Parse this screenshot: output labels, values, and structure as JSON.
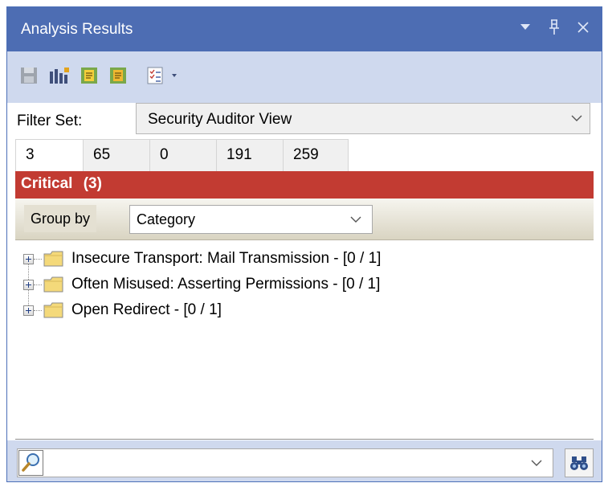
{
  "window": {
    "title": "Analysis Results",
    "title_buttons": [
      "dropdown-arrow-icon",
      "pin-icon",
      "close-icon"
    ]
  },
  "toolbar": {
    "tools": [
      "save-disk-icon",
      "chart-settings-icon",
      "report-icon",
      "report-alt-icon",
      "checklist-dropdown-icon"
    ]
  },
  "filter": {
    "label": "Filter Set:",
    "value": "Security Auditor View"
  },
  "tabs": [
    {
      "label": "3",
      "active": true
    },
    {
      "label": "65"
    },
    {
      "label": "0"
    },
    {
      "label": "191"
    },
    {
      "label": "259"
    }
  ],
  "critical": {
    "label": "Critical",
    "count": "(3)",
    "color": "#c23b32"
  },
  "group_by": {
    "label": "Group by",
    "value": "Category"
  },
  "tree": {
    "items": [
      {
        "label": "Insecure Transport: Mail Transmission - [0 / 1]"
      },
      {
        "label": "Often Misused: Asserting Permissions - [0 / 1]"
      },
      {
        "label": "Open Redirect - [0 / 1]"
      }
    ]
  },
  "search": {
    "value": "",
    "placeholder": ""
  },
  "colors": {
    "titlebar": "#4d6db3",
    "toolbar": "#cfd9ee",
    "critical": "#c23b32",
    "folder": "#f4d97a"
  }
}
